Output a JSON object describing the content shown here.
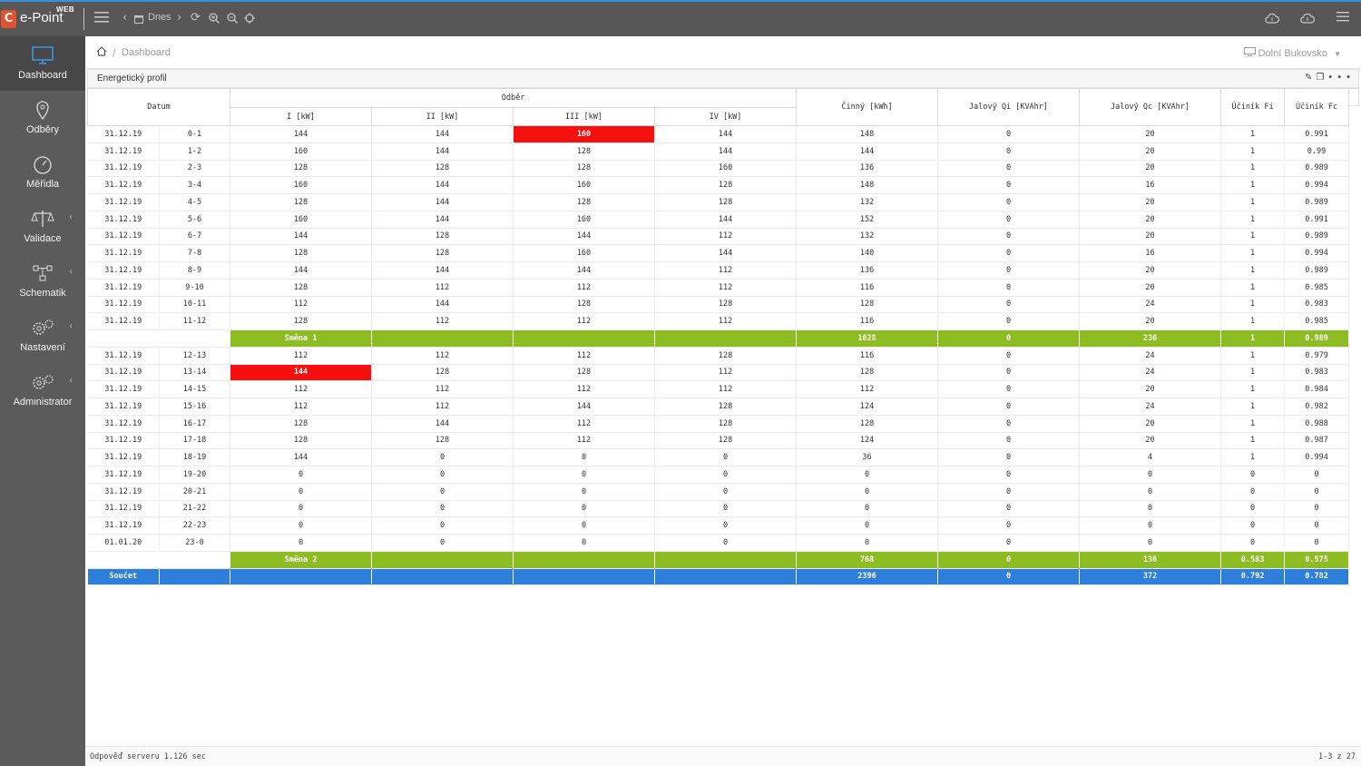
{
  "app": {
    "logo_text": "e-Point",
    "logo_web": "WEB",
    "logo_mark": "C"
  },
  "toolbar": {
    "today_label": "Dnes"
  },
  "sidebar": {
    "items": [
      {
        "label": "Dashboard",
        "icon": "monitor-icon",
        "active": true
      },
      {
        "label": "Odběry",
        "icon": "location-pin-icon"
      },
      {
        "label": "Měřidla",
        "icon": "gauge-icon"
      },
      {
        "label": "Validace",
        "icon": "scales-icon"
      },
      {
        "label": "Schematik",
        "icon": "schema-icon"
      },
      {
        "label": "Nastavení",
        "icon": "gears-icon"
      },
      {
        "label": "Administrator",
        "icon": "admin-gears-icon"
      }
    ]
  },
  "breadcrumb": {
    "page": "Dashboard",
    "location": "Dolní Bukovsko"
  },
  "panel": {
    "title": "Energetický profil"
  },
  "table": {
    "group_datum": "Datum",
    "group_odber": "Odběr",
    "sub_columns": [
      "I [kW]",
      "II [kW]",
      "III [kW]",
      "IV [kW]"
    ],
    "other_columns": [
      "Činný [kWh]",
      "Jalový Qi [KVAhr]",
      "Jalový Qc [KVAhr]",
      "Účiník Fi",
      "Účiník Fc"
    ],
    "highlight_color": "#f50f0f",
    "shift_color": "#8dbd22",
    "total_color": "#2e7fd9",
    "rows": [
      {
        "type": "data",
        "cells": [
          "31.12.19",
          "0-1",
          "144",
          "144",
          "160",
          "144",
          "148",
          "0",
          "20",
          "1",
          "0.991"
        ],
        "red": [
          4
        ]
      },
      {
        "type": "data",
        "cells": [
          "31.12.19",
          "1-2",
          "160",
          "144",
          "128",
          "144",
          "144",
          "0",
          "20",
          "1",
          "0.99"
        ]
      },
      {
        "type": "data",
        "cells": [
          "31.12.19",
          "2-3",
          "128",
          "128",
          "128",
          "160",
          "136",
          "0",
          "20",
          "1",
          "0.989"
        ]
      },
      {
        "type": "data",
        "cells": [
          "31.12.19",
          "3-4",
          "160",
          "144",
          "160",
          "128",
          "148",
          "0",
          "16",
          "1",
          "0.994"
        ]
      },
      {
        "type": "data",
        "cells": [
          "31.12.19",
          "4-5",
          "128",
          "144",
          "128",
          "128",
          "132",
          "0",
          "20",
          "1",
          "0.989"
        ]
      },
      {
        "type": "data",
        "cells": [
          "31.12.19",
          "5-6",
          "160",
          "144",
          "160",
          "144",
          "152",
          "0",
          "20",
          "1",
          "0.991"
        ]
      },
      {
        "type": "data",
        "cells": [
          "31.12.19",
          "6-7",
          "144",
          "128",
          "144",
          "112",
          "132",
          "0",
          "20",
          "1",
          "0.989"
        ]
      },
      {
        "type": "data",
        "cells": [
          "31.12.19",
          "7-8",
          "128",
          "128",
          "160",
          "144",
          "140",
          "0",
          "16",
          "1",
          "0.994"
        ]
      },
      {
        "type": "data",
        "cells": [
          "31.12.19",
          "8-9",
          "144",
          "144",
          "144",
          "112",
          "136",
          "0",
          "20",
          "1",
          "0.989"
        ]
      },
      {
        "type": "data",
        "cells": [
          "31.12.19",
          "9-10",
          "128",
          "112",
          "112",
          "112",
          "116",
          "0",
          "20",
          "1",
          "0.985"
        ]
      },
      {
        "type": "data",
        "cells": [
          "31.12.19",
          "10-11",
          "112",
          "144",
          "128",
          "128",
          "128",
          "0",
          "24",
          "1",
          "0.983"
        ]
      },
      {
        "type": "data",
        "cells": [
          "31.12.19",
          "11-12",
          "128",
          "112",
          "112",
          "112",
          "116",
          "0",
          "20",
          "1",
          "0.985"
        ]
      },
      {
        "type": "shift",
        "cells": [
          "",
          "",
          "Směna 1",
          "",
          "",
          "",
          "1628",
          "0",
          "236",
          "1",
          "0.989"
        ]
      },
      {
        "type": "data",
        "cells": [
          "31.12.19",
          "12-13",
          "112",
          "112",
          "112",
          "128",
          "116",
          "0",
          "24",
          "1",
          "0.979"
        ]
      },
      {
        "type": "data",
        "cells": [
          "31.12.19",
          "13-14",
          "144",
          "128",
          "128",
          "112",
          "128",
          "0",
          "24",
          "1",
          "0.983"
        ],
        "red": [
          2
        ]
      },
      {
        "type": "data",
        "cells": [
          "31.12.19",
          "14-15",
          "112",
          "112",
          "112",
          "112",
          "112",
          "0",
          "20",
          "1",
          "0.984"
        ]
      },
      {
        "type": "data",
        "cells": [
          "31.12.19",
          "15-16",
          "112",
          "112",
          "144",
          "128",
          "124",
          "0",
          "24",
          "1",
          "0.982"
        ]
      },
      {
        "type": "data",
        "cells": [
          "31.12.19",
          "16-17",
          "128",
          "144",
          "112",
          "128",
          "128",
          "0",
          "20",
          "1",
          "0.988"
        ]
      },
      {
        "type": "data",
        "cells": [
          "31.12.19",
          "17-18",
          "128",
          "128",
          "112",
          "128",
          "124",
          "0",
          "20",
          "1",
          "0.987"
        ]
      },
      {
        "type": "data",
        "cells": [
          "31.12.19",
          "18-19",
          "144",
          "0",
          "0",
          "0",
          "36",
          "0",
          "4",
          "1",
          "0.994"
        ]
      },
      {
        "type": "data",
        "cells": [
          "31.12.19",
          "19-20",
          "0",
          "0",
          "0",
          "0",
          "0",
          "0",
          "0",
          "0",
          "0"
        ]
      },
      {
        "type": "data",
        "cells": [
          "31.12.19",
          "20-21",
          "0",
          "0",
          "0",
          "0",
          "0",
          "0",
          "0",
          "0",
          "0"
        ]
      },
      {
        "type": "data",
        "cells": [
          "31.12.19",
          "21-22",
          "0",
          "0",
          "0",
          "0",
          "0",
          "0",
          "0",
          "0",
          "0"
        ]
      },
      {
        "type": "data",
        "cells": [
          "31.12.19",
          "22-23",
          "0",
          "0",
          "0",
          "0",
          "0",
          "0",
          "0",
          "0",
          "0"
        ]
      },
      {
        "type": "data",
        "cells": [
          "01.01.20",
          "23-0",
          "0",
          "0",
          "0",
          "0",
          "0",
          "0",
          "0",
          "0",
          "0"
        ]
      },
      {
        "type": "shift",
        "cells": [
          "",
          "",
          "Směna 2",
          "",
          "",
          "",
          "768",
          "0",
          "136",
          "0.583",
          "0.575"
        ]
      },
      {
        "type": "total",
        "cells": [
          "Součet",
          "",
          "",
          "",
          "",
          "",
          "2396",
          "0",
          "372",
          "0.792",
          "0.782"
        ]
      }
    ]
  },
  "footer": {
    "server_response": "Odpověď serveru 1.126 sec",
    "pagination": "1-3 z 27"
  }
}
